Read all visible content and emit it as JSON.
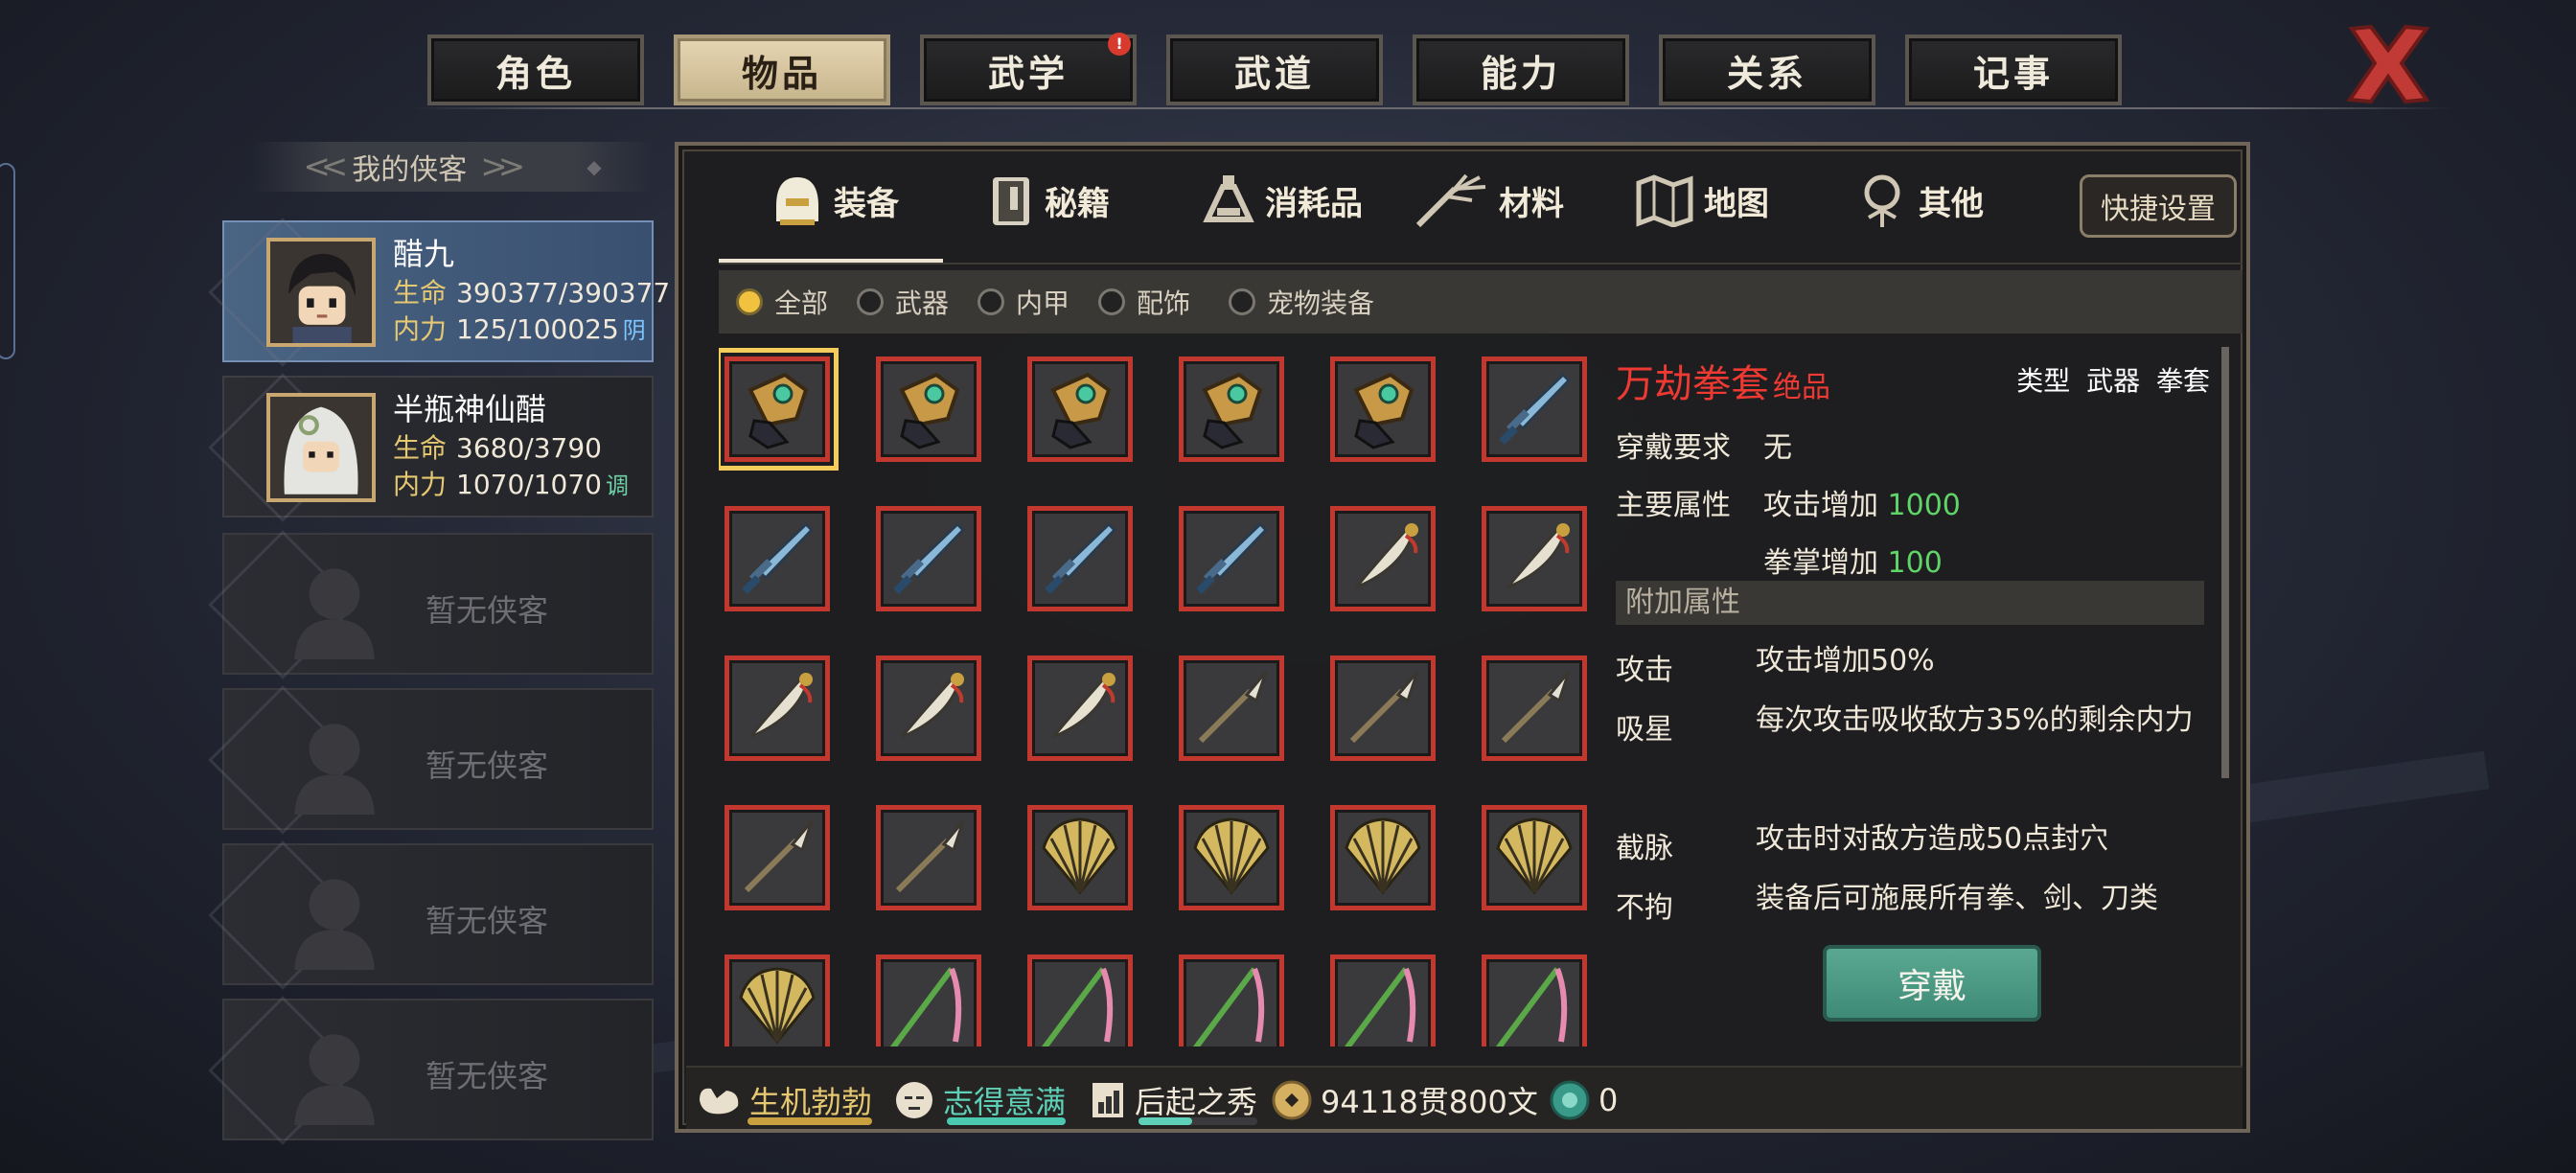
{
  "top_tabs": [
    {
      "label": "角色"
    },
    {
      "label": "物品",
      "active": true
    },
    {
      "label": "武学",
      "badge": "!"
    },
    {
      "label": "武道"
    },
    {
      "label": "能力"
    },
    {
      "label": "关系"
    },
    {
      "label": "记事"
    }
  ],
  "heroes_header": "我的侠客",
  "heroes": [
    {
      "name": "醋九",
      "hp_label": "生命",
      "hp": "390377/390377",
      "mp_label": "内力",
      "mp": "125/100025",
      "tag": "阴"
    },
    {
      "name": "半瓶神仙醋",
      "hp_label": "生命",
      "hp": "3680/3790",
      "mp_label": "内力",
      "mp": "1070/1070",
      "tag": "调"
    }
  ],
  "empty_slot_label": "暂无侠客",
  "category_tabs": [
    {
      "label": "装备",
      "icon": "helmet-icon",
      "active": true
    },
    {
      "label": "秘籍",
      "icon": "book-icon"
    },
    {
      "label": "消耗品",
      "icon": "potion-flask-icon"
    },
    {
      "label": "材料",
      "icon": "herb-icon"
    },
    {
      "label": "地图",
      "icon": "map-icon"
    },
    {
      "label": "其他",
      "icon": "lantern-icon"
    }
  ],
  "quick_settings_label": "快捷设置",
  "filters": [
    {
      "label": "全部",
      "on": true
    },
    {
      "label": "武器"
    },
    {
      "label": "内甲"
    },
    {
      "label": "配饰"
    },
    {
      "label": "宠物装备"
    }
  ],
  "items": [
    "fist-gauntlet-icon",
    "fist-gauntlet-icon",
    "fist-gauntlet-icon",
    "fist-gauntlet-icon",
    "fist-gauntlet-icon",
    "sword-icon",
    "sword-icon",
    "sword-icon",
    "sword-icon",
    "sword-icon",
    "saber-icon",
    "saber-icon",
    "saber-icon",
    "saber-icon",
    "saber-icon",
    "spear-icon",
    "spear-icon",
    "spear-icon",
    "spear-icon",
    "spear-icon",
    "fan-icon",
    "fan-icon",
    "fan-icon",
    "fan-icon",
    "fan-icon",
    "whip-icon",
    "whip-icon",
    "whip-icon",
    "whip-icon",
    "whip-icon"
  ],
  "detail": {
    "name": "万劫拳套",
    "grade": "绝品",
    "type": "类型 武器 拳套",
    "req_label": "穿戴要求",
    "req_value": "无",
    "main_label": "主要属性",
    "main_attrs": [
      {
        "name": "攻击增加",
        "value": "1000"
      },
      {
        "name": "拳掌增加",
        "value": "100"
      }
    ],
    "extra_header": "附加属性",
    "effects": [
      {
        "name": "攻击",
        "desc": "攻击增加50%"
      },
      {
        "name": "吸星",
        "desc": "每次攻击吸收敌方35%的剩余内力"
      },
      {
        "name": "截脉",
        "desc": "攻击时对敌方造成50点封穴"
      },
      {
        "name": "不拘",
        "desc": "装备后可施展所有拳、剑、刀类"
      }
    ],
    "equip_button": "穿戴"
  },
  "status": {
    "vigor": "生机勃勃",
    "mood": "志得意满",
    "rank": "后起之秀",
    "money": "94118贯800文",
    "gems": "0"
  },
  "colors": {
    "accent_red": "#ee3a32",
    "attr_green": "#5fd468",
    "selected_gold": "#f4cc5c",
    "button_teal": "#4a9a84"
  }
}
